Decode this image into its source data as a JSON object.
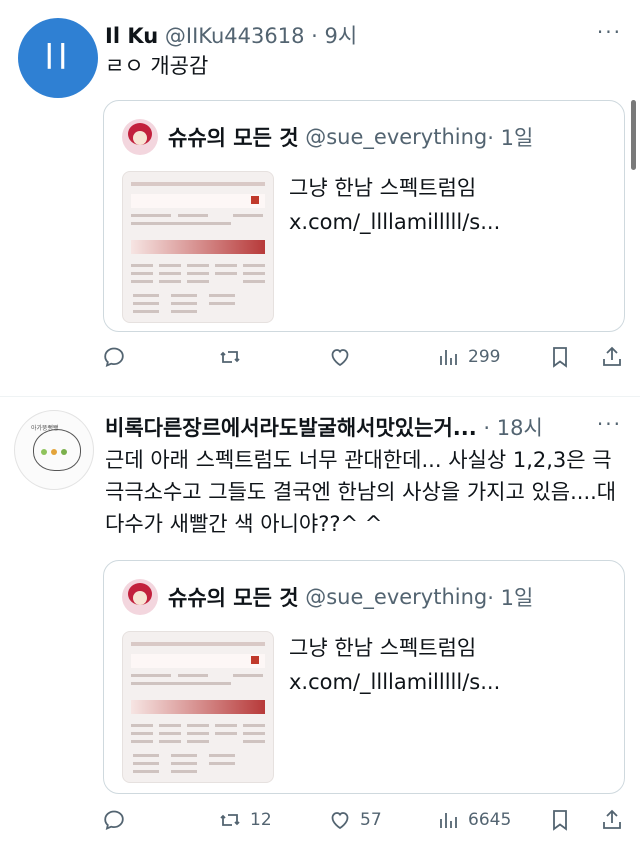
{
  "tweets": [
    {
      "name": "Il Ku",
      "handle": "@IIKu443618",
      "time": "· 9시",
      "avatar_text": "ll",
      "text": "ㄹㅇ 개공감",
      "quote": {
        "name": "슈슈의 모든 것",
        "handle": "@sue_everything",
        "time": "· 1일",
        "text": "그냥 한남 스펙트럼임 x.com/_llllamilllll/s..."
      },
      "actions": {
        "reply": "",
        "retweet": "",
        "like": "",
        "views": "299"
      }
    },
    {
      "name": "비록다른장르에서라도발굴해서맛있는거...",
      "time": "· 18시",
      "avatar_text": "아가뚱뻥뻥",
      "text": "근데 아래 스펙트럼도 너무 관대한데... 사실상 1,2,3은 극극극소수고 그들도 결국엔 한남의 사상을 가지고 있음....대다수가 새빨간 색 아니야??^ ^",
      "quote": {
        "name": "슈슈의 모든 것",
        "handle": "@sue_everything",
        "time": "· 1일",
        "text": "그냥 한남 스펙트럼임 x.com/_llllamilllll/s..."
      },
      "actions": {
        "reply": "",
        "retweet": "12",
        "like": "57",
        "views": "6645"
      }
    }
  ],
  "more_label": "···",
  "icons": [
    "reply-icon",
    "retweet-icon",
    "like-icon",
    "views-icon",
    "bookmark-icon",
    "share-icon"
  ],
  "colors": {
    "brand_blue": "#2f80d3",
    "meta_gray": "#536471",
    "border": "#cfd9de",
    "spectrum_red": "#b73a3a"
  }
}
